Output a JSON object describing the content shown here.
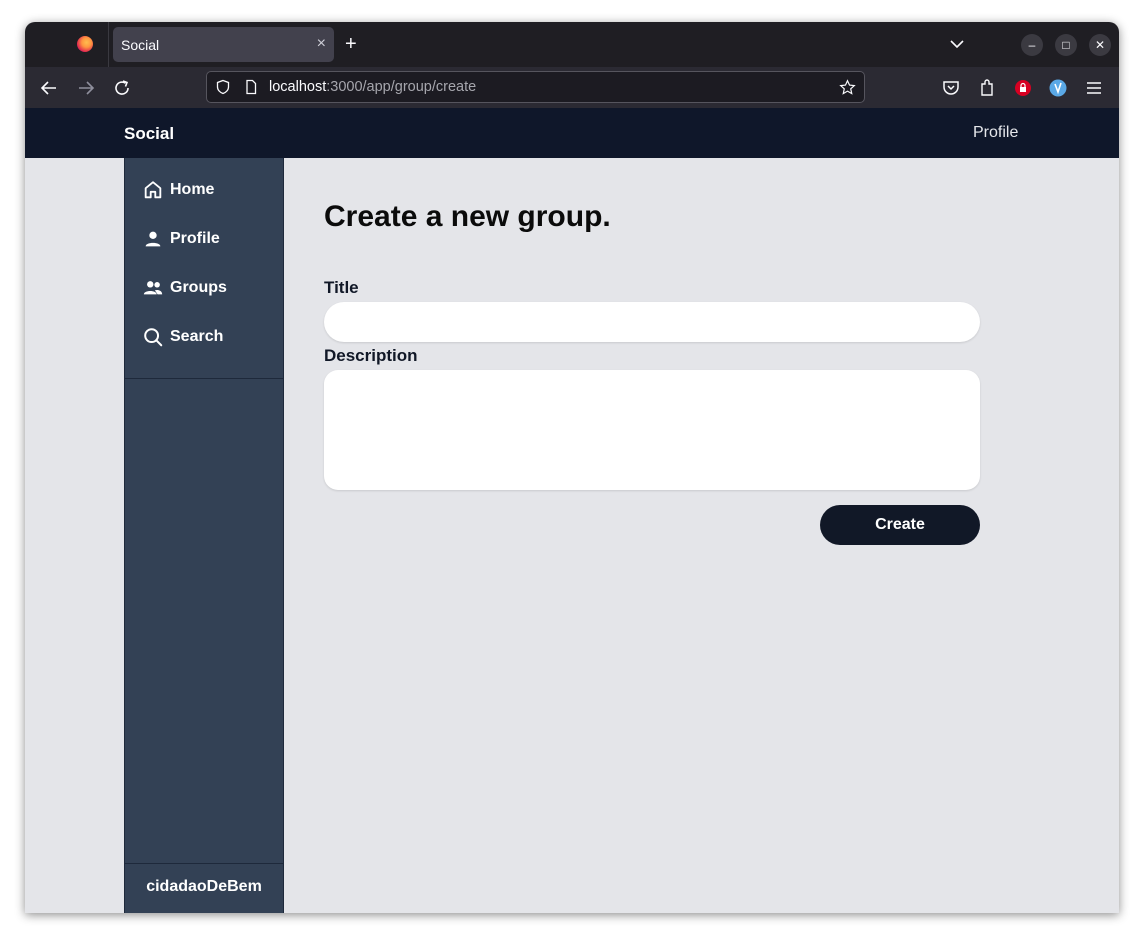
{
  "browser": {
    "tab_title": "Social",
    "tab_close": "×",
    "new_tab": "+",
    "url_host": "localhost",
    "url_path": ":3000/app/group/create",
    "minimize": "–",
    "maximize": "□",
    "close": "✕"
  },
  "header": {
    "brand": "Social",
    "profile_link": "Profile"
  },
  "sidebar": {
    "items": [
      {
        "label": "Home",
        "icon": "home-icon"
      },
      {
        "label": "Profile",
        "icon": "user-icon"
      },
      {
        "label": "Groups",
        "icon": "users-icon"
      },
      {
        "label": "Search",
        "icon": "search-icon"
      }
    ],
    "username": "cidadaoDeBem"
  },
  "form": {
    "heading": "Create a new group.",
    "title_label": "Title",
    "title_value": "",
    "description_label": "Description",
    "description_value": "",
    "submit_label": "Create"
  },
  "colors": {
    "header_bg": "#0f172a",
    "sidebar_bg": "#334155",
    "page_bg": "#e4e5e9",
    "button_bg": "#111827"
  }
}
